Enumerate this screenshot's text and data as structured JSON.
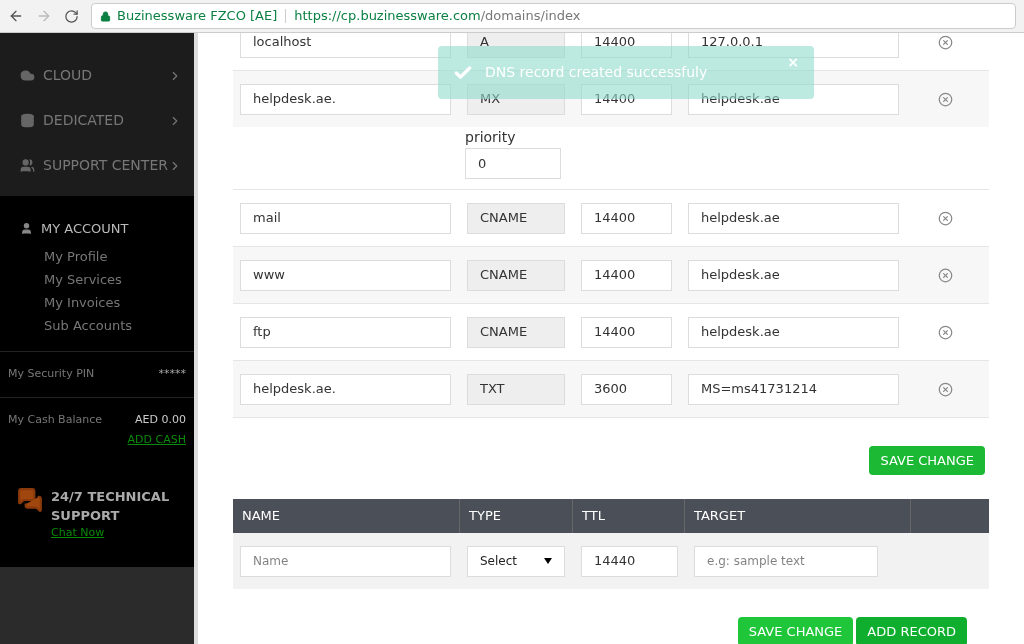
{
  "browser": {
    "site_name": "Buzinessware FZCO [AE]",
    "url_host": "https://cp.buzinessware.com",
    "url_path": "/domains/index"
  },
  "sidebar": {
    "menu": [
      {
        "label": "CLOUD",
        "kind": "cloud"
      },
      {
        "label": "DEDICATED",
        "kind": "dedicated"
      },
      {
        "label": "SUPPORT CENTER",
        "kind": "support"
      }
    ],
    "account": {
      "title": "MY ACCOUNT",
      "items": [
        "My Profile",
        "My Services",
        "My Invoices",
        "Sub Accounts"
      ]
    },
    "security_pin": {
      "label": "My Security PIN",
      "value": "*****"
    },
    "cash_balance": {
      "label": "My Cash Balance",
      "value": "AED 0.00",
      "link": "ADD CASH"
    },
    "support": {
      "title": "24/7 TECHNICAL SUPPORT",
      "link": "Chat Now"
    }
  },
  "toast": {
    "message": "DNS record created successfuly",
    "close": "×"
  },
  "records": [
    {
      "name": "localhost",
      "type": "A",
      "ttl": "14400",
      "target": "127.0.0.1"
    },
    {
      "name": "helpdesk.ae.",
      "type": "MX",
      "ttl": "14400",
      "target": "helpdesk.ae",
      "priority_label": "priority",
      "priority": "0"
    },
    {
      "name": "mail",
      "type": "CNAME",
      "ttl": "14400",
      "target": "helpdesk.ae"
    },
    {
      "name": "www",
      "type": "CNAME",
      "ttl": "14400",
      "target": "helpdesk.ae"
    },
    {
      "name": "ftp",
      "type": "CNAME",
      "ttl": "14400",
      "target": "helpdesk.ae"
    },
    {
      "name": "helpdesk.ae.",
      "type": "TXT",
      "ttl": "3600",
      "target": "MS=ms41731214"
    }
  ],
  "save_button": "SAVE CHANGE",
  "new_record": {
    "columns": [
      "NAME",
      "TYPE",
      "TTL",
      "TARGET"
    ],
    "name_placeholder": "Name",
    "type_value": "Select",
    "ttl": "14440",
    "target_placeholder": "e.g: sample text"
  },
  "bottom_buttons": [
    "SAVE CHANGE",
    "ADD RECORD"
  ]
}
